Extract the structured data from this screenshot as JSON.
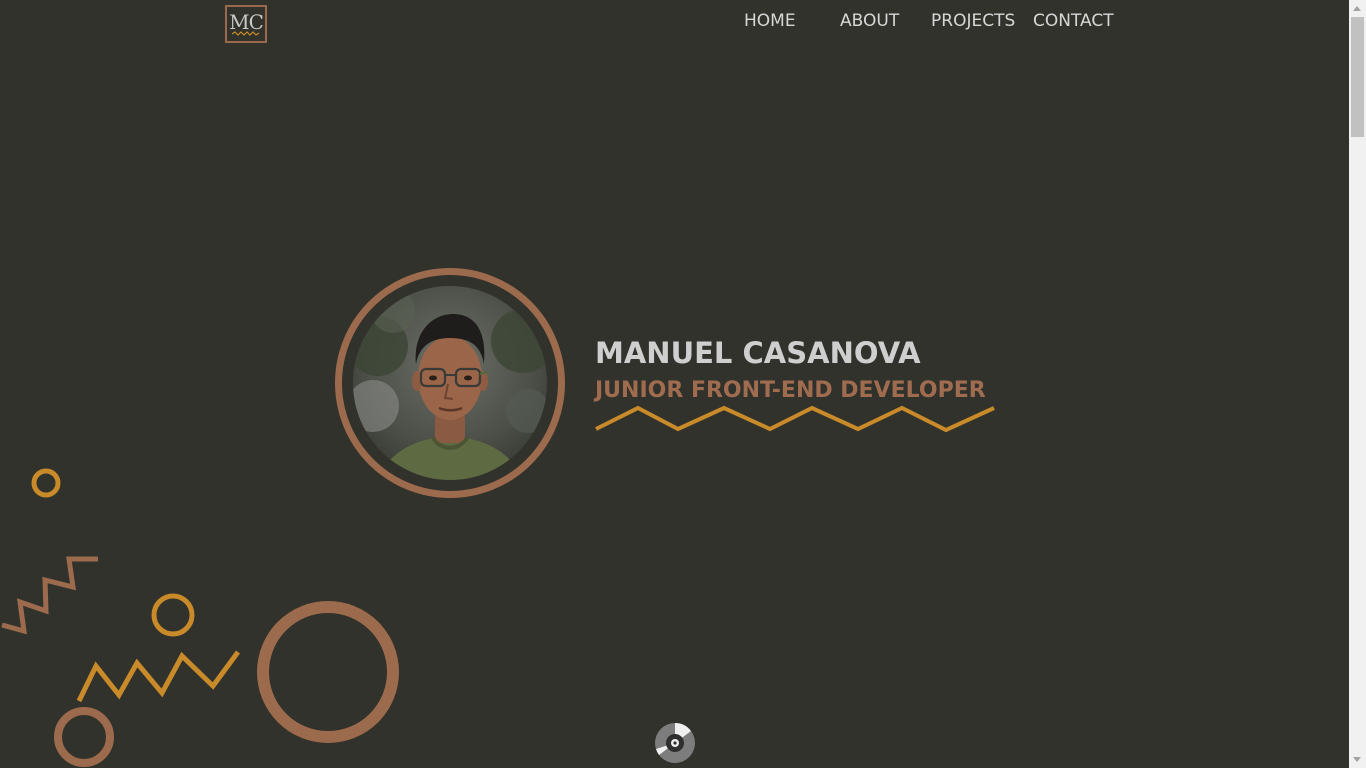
{
  "header": {
    "logo_text": "MC",
    "nav": [
      {
        "label": "HOME"
      },
      {
        "label": "ABOUT"
      },
      {
        "label": "PROJECTS"
      },
      {
        "label": "CONTACT"
      }
    ]
  },
  "hero": {
    "name": "MANUEL CASANOVA",
    "role": "JUNIOR FRONT-END DEVELOPER",
    "portrait_icon": "profile-photo"
  },
  "scroll_button": {
    "icon": "vinyl-disc-icon"
  },
  "colors": {
    "background": "#31322b",
    "nav_text": "#d7d7d7",
    "name_text": "#cfcfcf",
    "brown_accent": "#9c6a4d",
    "gold_accent": "#c98a2a"
  }
}
